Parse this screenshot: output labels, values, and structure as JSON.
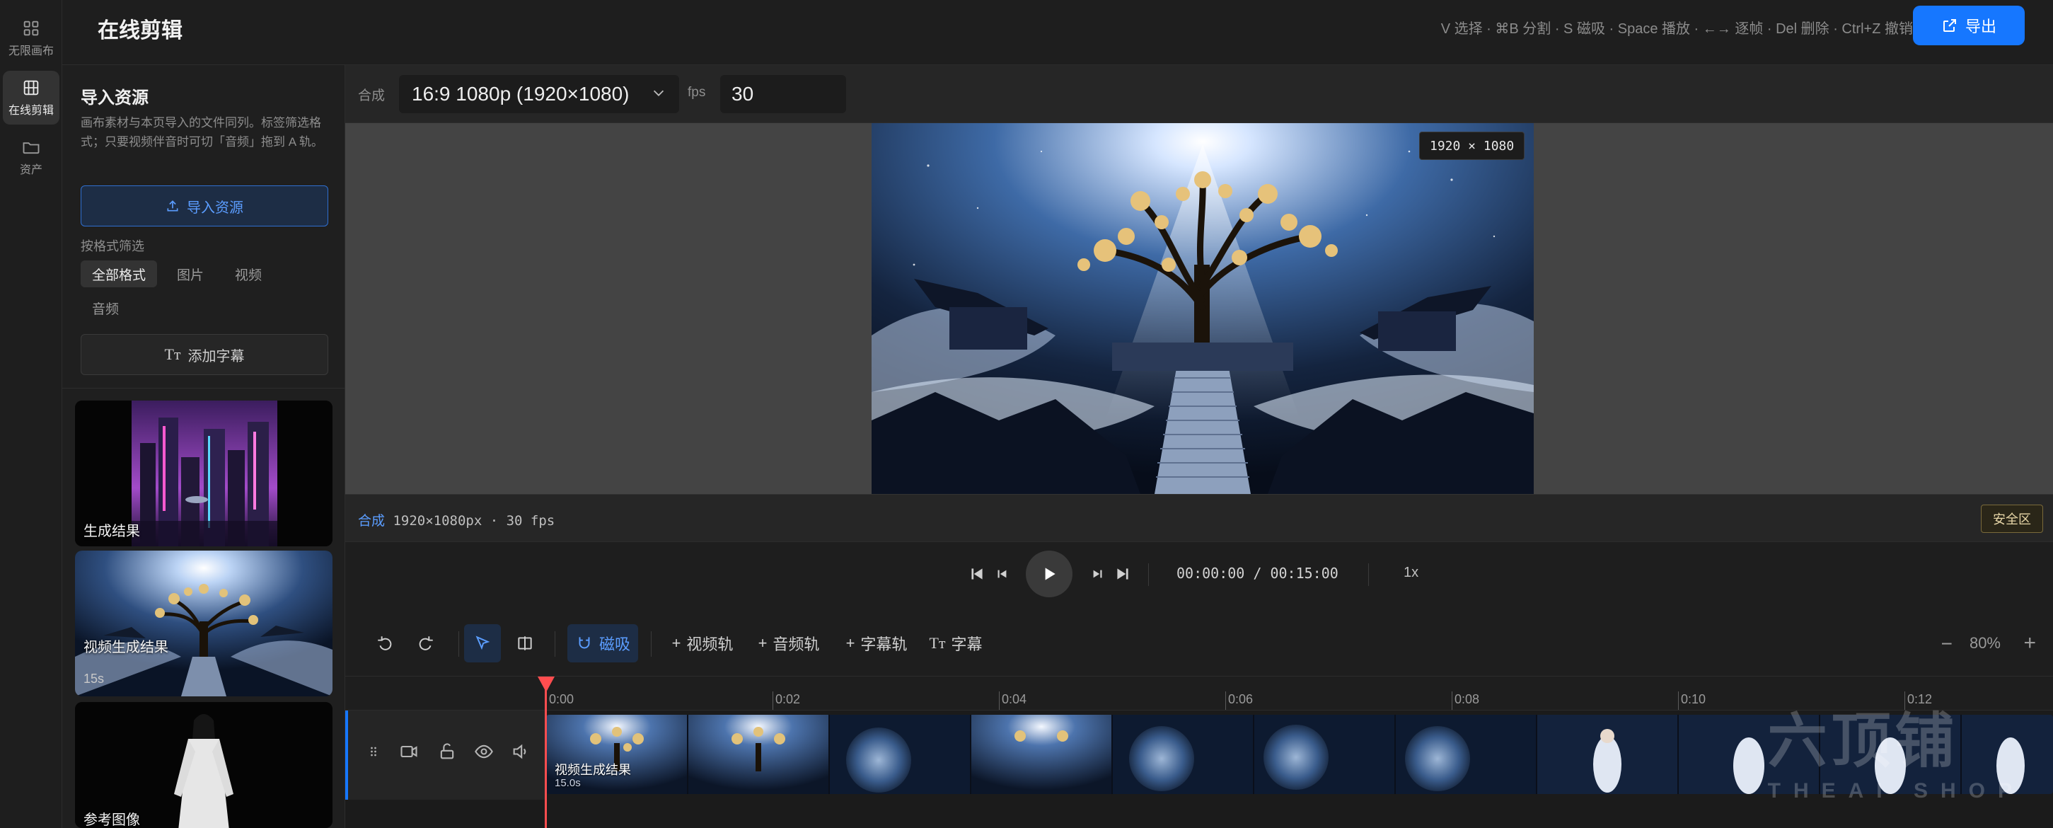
{
  "nav": {
    "items": [
      {
        "label": "无限画布",
        "icon": "grid-icon"
      },
      {
        "label": "在线剪辑",
        "icon": "film-icon"
      },
      {
        "label": "资产",
        "icon": "folder-icon"
      }
    ]
  },
  "header": {
    "title": "在线剪辑",
    "shortcuts": "V 选择 · ⌘B 分割 · S 磁吸 · Space 播放 · ←→ 逐帧 · Del 删除 · Ctrl+Z 撤销",
    "export_label": "导出"
  },
  "panel": {
    "title": "导入资源",
    "description": "画布素材与本页导入的文件同列。标签筛选格式；只要视频伴音时可切「音频」拖到 A 轨。",
    "import_label": "导入资源",
    "filter_label": "按格式筛选",
    "filters": [
      "全部格式",
      "图片",
      "视频",
      "音频"
    ],
    "active_filter": "全部格式",
    "add_subtitle_label": "添加字幕",
    "assets": [
      {
        "label": "生成结果",
        "duration": ""
      },
      {
        "label": "视频生成结果",
        "duration": "15s"
      },
      {
        "label": "参考图像",
        "duration": ""
      }
    ]
  },
  "composition": {
    "label": "合成",
    "resolution": "16:9 1080p (1920×1080)",
    "fps_label": "fps",
    "fps_value": "30"
  },
  "preview": {
    "res_badge": "1920 × 1080"
  },
  "info": {
    "prefix": "合成",
    "text": "1920×1080px · 30 fps",
    "safe_zone_label": "安全区"
  },
  "transport": {
    "timecode": "00:00:00 / 00:15:00",
    "speed": "1x"
  },
  "toolbar": {
    "snap_label": "磁吸",
    "add_video_track": "视频轨",
    "add_audio_track": "音频轨",
    "add_subtitle_track": "字幕轨",
    "subtitle_label": "字幕",
    "zoom": "80%"
  },
  "timeline": {
    "ruler_labels": [
      "0:00",
      "0:02",
      "0:04",
      "0:06",
      "0:08",
      "0:10",
      "0:12"
    ],
    "clip": {
      "label": "视频生成结果",
      "duration": "15.0s"
    }
  },
  "watermark": {
    "main": "六顶铺",
    "sub": "THEAI SHOP"
  },
  "colors": {
    "accent": "#1677ff",
    "playhead": "#ff4d4f",
    "stage_bg": "#444444"
  }
}
